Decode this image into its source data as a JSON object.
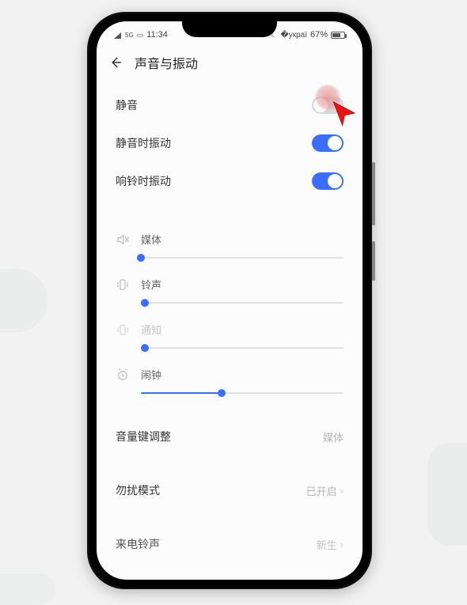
{
  "statusbar": {
    "time": "11:34",
    "battery_text": "67%",
    "network_label": "5G"
  },
  "header": {
    "title": "声音与振动"
  },
  "toggles": {
    "silent": {
      "label": "静音",
      "on": false
    },
    "vibrate_on_silent": {
      "label": "静音时振动",
      "on": true
    },
    "vibrate_on_ring": {
      "label": "响铃时振动",
      "on": true
    }
  },
  "sliders": {
    "media": {
      "label": "媒体",
      "value": 0,
      "disabled": false
    },
    "ring": {
      "label": "铃声",
      "value": 2,
      "disabled": false
    },
    "notify": {
      "label": "通知",
      "value": 2,
      "disabled": true
    },
    "alarm": {
      "label": "闹钟",
      "value": 40,
      "disabled": false
    }
  },
  "rows": {
    "volume_keys": {
      "label": "音量键调整",
      "value": "媒体"
    },
    "dnd": {
      "label": "勿扰模式",
      "value": "已开启"
    },
    "ringtone": {
      "label": "来电铃声",
      "value": "新生"
    }
  },
  "colors": {
    "accent": "#3a6eff",
    "text": "#333333",
    "muted": "#b5b5b5"
  }
}
